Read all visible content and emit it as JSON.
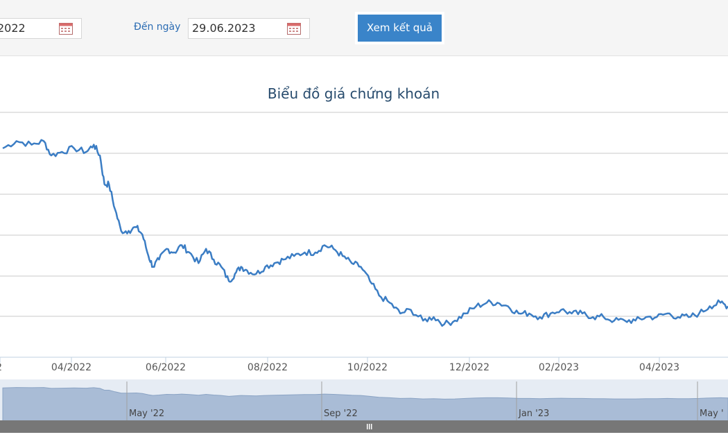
{
  "filter": {
    "from_date_value": "2022",
    "to_label": "Đến ngày",
    "to_date_value": "29.06.2023",
    "submit_label": "Xem kết quả"
  },
  "chart_data": {
    "type": "line",
    "title": "Biểu đồ giá chứng khoán",
    "xlabel": "",
    "ylabel": "",
    "x_ticks": [
      "2",
      "04/2022",
      "06/2022",
      "08/2022",
      "10/2022",
      "12/2022",
      "02/2023",
      "04/2023"
    ],
    "navigator_labels": [
      "May '22",
      "Sep '22",
      "Jan '23",
      "May '"
    ],
    "grid": true,
    "line_color": "#3b7dc4",
    "series": [
      {
        "name": "",
        "points": [
          [
            "2022-02-01",
            7.4
          ],
          [
            "2022-02-10",
            7.5
          ],
          [
            "2022-02-20",
            7.45
          ],
          [
            "2022-02-28",
            7.5
          ],
          [
            "2022-03-05",
            7.3
          ],
          [
            "2022-03-12",
            7.35
          ],
          [
            "2022-03-20",
            7.4
          ],
          [
            "2022-03-28",
            7.35
          ],
          [
            "2022-04-02",
            7.45
          ],
          [
            "2022-04-06",
            7.3
          ],
          [
            "2022-04-09",
            6.9
          ],
          [
            "2022-04-12",
            6.9
          ],
          [
            "2022-04-16",
            6.55
          ],
          [
            "2022-04-20",
            6.25
          ],
          [
            "2022-04-25",
            6.25
          ],
          [
            "2022-04-30",
            6.3
          ],
          [
            "2022-05-04",
            6.2
          ],
          [
            "2022-05-08",
            5.9
          ],
          [
            "2022-05-11",
            5.75
          ],
          [
            "2022-05-15",
            5.85
          ],
          [
            "2022-05-20",
            6.0
          ],
          [
            "2022-05-25",
            5.95
          ],
          [
            "2022-05-30",
            6.05
          ],
          [
            "2022-06-04",
            5.95
          ],
          [
            "2022-06-10",
            5.8
          ],
          [
            "2022-06-15",
            6.0
          ],
          [
            "2022-06-20",
            5.85
          ],
          [
            "2022-06-25",
            5.75
          ],
          [
            "2022-06-30",
            5.55
          ],
          [
            "2022-07-04",
            5.65
          ],
          [
            "2022-07-08",
            5.75
          ],
          [
            "2022-07-12",
            5.7
          ],
          [
            "2022-07-18",
            5.65
          ],
          [
            "2022-07-24",
            5.75
          ],
          [
            "2022-07-30",
            5.8
          ],
          [
            "2022-08-05",
            5.85
          ],
          [
            "2022-08-12",
            5.9
          ],
          [
            "2022-08-19",
            5.95
          ],
          [
            "2022-08-26",
            5.95
          ],
          [
            "2022-09-01",
            6.05
          ],
          [
            "2022-09-07",
            6.0
          ],
          [
            "2022-09-13",
            5.9
          ],
          [
            "2022-09-19",
            5.8
          ],
          [
            "2022-09-25",
            5.75
          ],
          [
            "2022-10-01",
            5.55
          ],
          [
            "2022-10-07",
            5.35
          ],
          [
            "2022-10-14",
            5.25
          ],
          [
            "2022-10-21",
            5.1
          ],
          [
            "2022-10-28",
            5.15
          ],
          [
            "2022-11-05",
            5.0
          ],
          [
            "2022-11-12",
            5.05
          ],
          [
            "2022-11-19",
            4.95
          ],
          [
            "2022-11-26",
            5.0
          ],
          [
            "2022-12-03",
            5.1
          ],
          [
            "2022-12-10",
            5.2
          ],
          [
            "2022-12-17",
            5.25
          ],
          [
            "2022-12-24",
            5.25
          ],
          [
            "2022-12-31",
            5.2
          ],
          [
            "2023-01-07",
            5.1
          ],
          [
            "2023-01-14",
            5.1
          ],
          [
            "2023-01-21",
            5.05
          ],
          [
            "2023-01-28",
            5.1
          ],
          [
            "2023-02-04",
            5.15
          ],
          [
            "2023-02-11",
            5.1
          ],
          [
            "2023-02-18",
            5.1
          ],
          [
            "2023-02-25",
            5.05
          ],
          [
            "2023-03-04",
            5.05
          ],
          [
            "2023-03-11",
            5.0
          ],
          [
            "2023-03-18",
            5.0
          ],
          [
            "2023-03-25",
            5.0
          ],
          [
            "2023-04-01",
            5.05
          ],
          [
            "2023-04-08",
            5.05
          ],
          [
            "2023-04-15",
            5.1
          ],
          [
            "2023-04-22",
            5.05
          ],
          [
            "2023-04-29",
            5.05
          ],
          [
            "2023-05-06",
            5.1
          ],
          [
            "2023-05-13",
            5.2
          ],
          [
            "2023-05-20",
            5.25
          ],
          [
            "2023-05-25",
            5.2
          ]
        ]
      }
    ]
  }
}
